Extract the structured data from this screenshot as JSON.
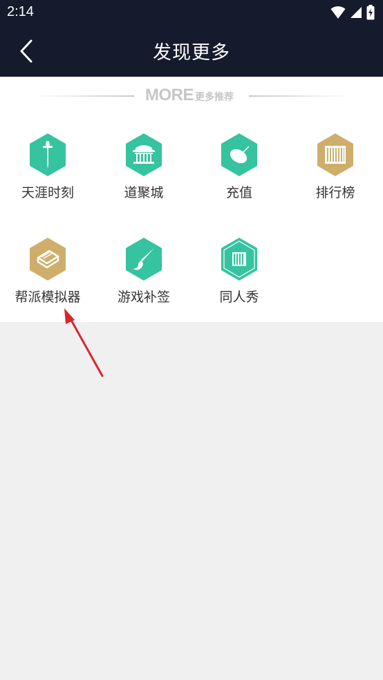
{
  "status_bar": {
    "time": "2:14"
  },
  "header": {
    "title": "发现更多"
  },
  "section": {
    "more_en": "MORE",
    "more_cn": "更多推荐"
  },
  "items": [
    {
      "label": "天涯时刻",
      "icon": "sword-icon",
      "color": "#35c3a0"
    },
    {
      "label": "道聚城",
      "icon": "temple-icon",
      "color": "#35c3a0"
    },
    {
      "label": "充值",
      "icon": "coin-icon",
      "color": "#35c3a0"
    },
    {
      "label": "排行榜",
      "icon": "scroll-icon",
      "color": "#cfae6c"
    },
    {
      "label": "帮派模拟器",
      "icon": "book-icon",
      "color": "#cfae6c"
    },
    {
      "label": "游戏补签",
      "icon": "brush-icon",
      "color": "#35c3a0"
    },
    {
      "label": "同人秀",
      "icon": "bamboo-scroll-icon",
      "color": "#35c3a0"
    }
  ],
  "colors": {
    "header_bg": "#151a2d",
    "teal": "#35c3a0",
    "gold": "#cfae6c",
    "annotation_arrow": "#d9262c"
  }
}
